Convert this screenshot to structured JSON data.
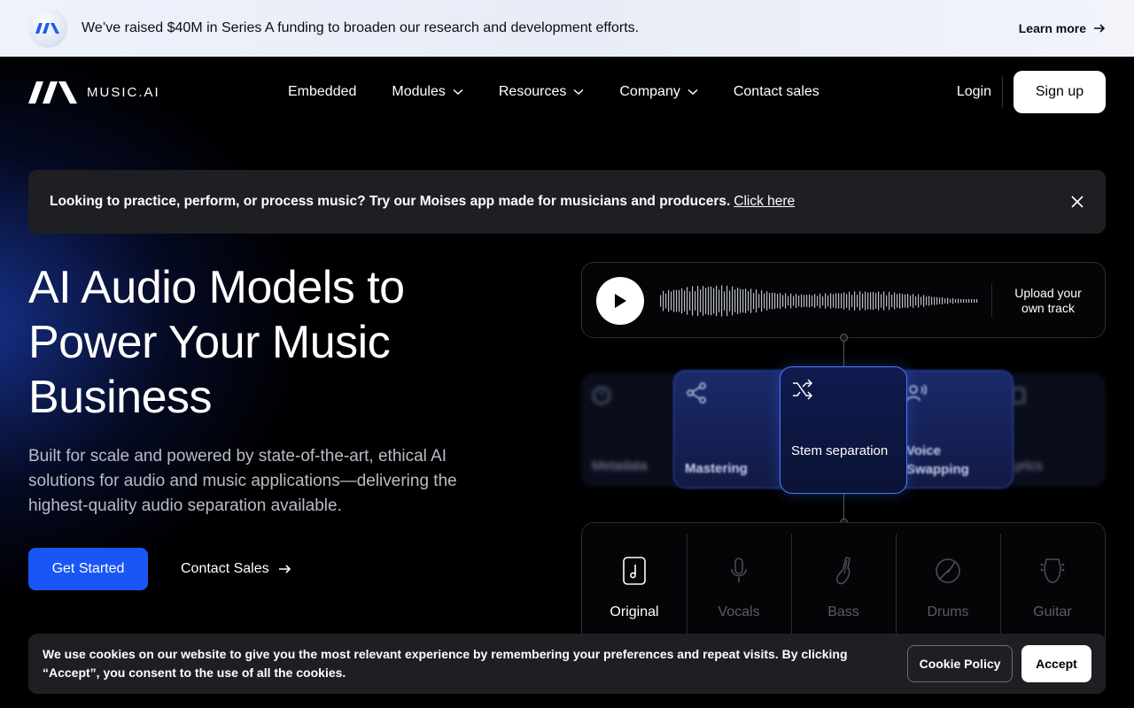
{
  "announcement": {
    "message": "We’ve raised $40M in Series A funding to broaden our research and development efforts.",
    "link_label": "Learn more"
  },
  "nav": {
    "logo_text": "MUSIC.AI",
    "items": [
      {
        "label": "Embedded",
        "has_dropdown": false
      },
      {
        "label": "Modules",
        "has_dropdown": true
      },
      {
        "label": "Resources",
        "has_dropdown": true
      },
      {
        "label": "Company",
        "has_dropdown": true
      },
      {
        "label": "Contact sales",
        "has_dropdown": false
      }
    ],
    "login": "Login",
    "signup": "Sign up"
  },
  "info_banner": {
    "text": "Looking to practice, perform, or process music? Try our Moises app made for musicians and producers.",
    "link": "Click here"
  },
  "hero": {
    "title": "AI Audio Models to Power Your Music Business",
    "subtitle": "Built for scale and powered by state-of-the-art, ethical AI solutions for audio and music applications—delivering the highest-quality audio separation available.",
    "primary_cta": "Get Started",
    "secondary_cta": "Contact Sales"
  },
  "player": {
    "upload_label": "Upload your own track"
  },
  "modules": [
    {
      "label": "Metadata",
      "icon": "metadata-icon",
      "state": "far"
    },
    {
      "label": "Mastering",
      "icon": "share-icon",
      "state": "mid"
    },
    {
      "label": "Stem separation",
      "icon": "shuffle-icon",
      "state": "active"
    },
    {
      "label": "Voice Swapping",
      "icon": "voice-icon",
      "state": "mid"
    },
    {
      "label": "Lyrics",
      "icon": "lyrics-icon",
      "state": "far"
    }
  ],
  "stems": [
    {
      "label": "Original",
      "icon": "music-file-icon",
      "active": true
    },
    {
      "label": "Vocals",
      "icon": "microphone-icon",
      "active": false
    },
    {
      "label": "Bass",
      "icon": "bass-guitar-icon",
      "active": false
    },
    {
      "label": "Drums",
      "icon": "drum-icon",
      "active": false
    },
    {
      "label": "Guitar",
      "icon": "guitar-icon",
      "active": false
    }
  ],
  "cookie": {
    "text": "We use cookies on our website to give you the most relevant experience by remembering your preferences and repeat visits. By clicking “Accept”, you consent to the use of all the cookies.",
    "policy": "Cookie Policy",
    "accept": "Accept"
  },
  "colors": {
    "accent": "#1a56f5",
    "active_border": "#4d7cff",
    "panel": "#1e1f22"
  }
}
